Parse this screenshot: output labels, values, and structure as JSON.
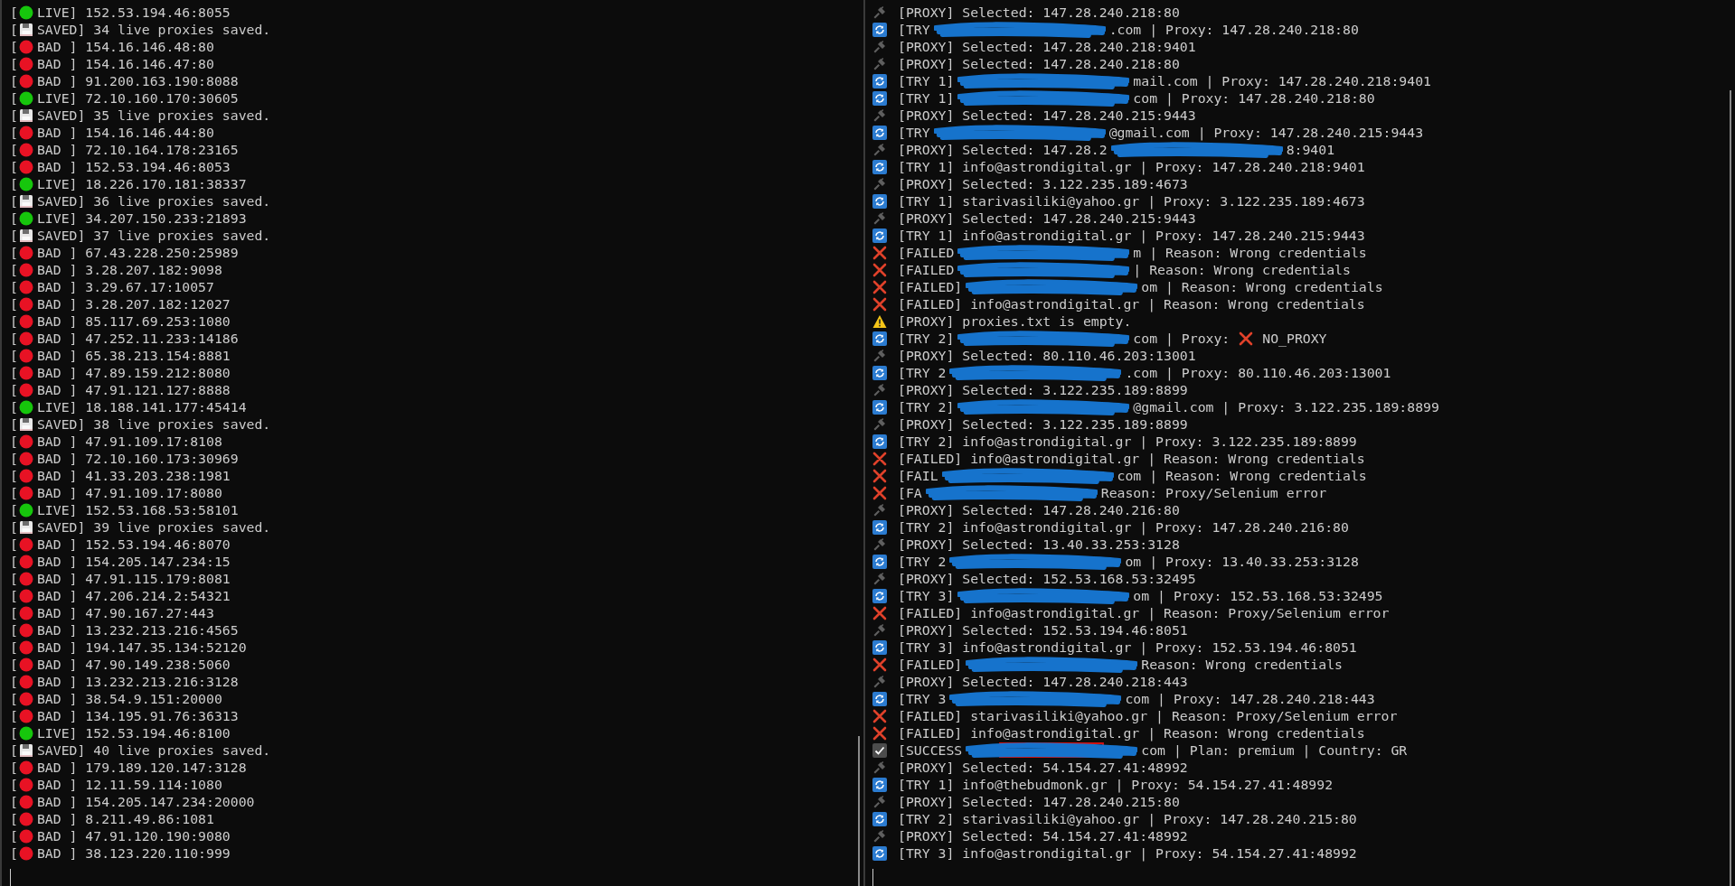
{
  "left_pane": {
    "lines": [
      {
        "kind": "live",
        "bracket": "[",
        "text": "LIVE] 152.53.194.46:8055"
      },
      {
        "kind": "saved",
        "bracket": "[",
        "text": "SAVED] 34 live proxies saved."
      },
      {
        "kind": "bad",
        "bracket": "[",
        "text": "BAD ] 154.16.146.48:80"
      },
      {
        "kind": "bad",
        "bracket": "[",
        "text": "BAD ] 154.16.146.47:80"
      },
      {
        "kind": "bad",
        "bracket": "[",
        "text": "BAD ] 91.200.163.190:8088"
      },
      {
        "kind": "live",
        "bracket": "[",
        "text": "LIVE] 72.10.160.170:30605"
      },
      {
        "kind": "saved",
        "bracket": "[",
        "text": "SAVED] 35 live proxies saved."
      },
      {
        "kind": "bad",
        "bracket": "[",
        "text": "BAD ] 154.16.146.44:80"
      },
      {
        "kind": "bad",
        "bracket": "[",
        "text": "BAD ] 72.10.164.178:23165"
      },
      {
        "kind": "bad",
        "bracket": "[",
        "text": "BAD ] 152.53.194.46:8053"
      },
      {
        "kind": "live",
        "bracket": "[",
        "text": "LIVE] 18.226.170.181:38337"
      },
      {
        "kind": "saved",
        "bracket": "[",
        "text": "SAVED] 36 live proxies saved."
      },
      {
        "kind": "live",
        "bracket": "[",
        "text": "LIVE] 34.207.150.233:21893"
      },
      {
        "kind": "saved",
        "bracket": "[",
        "text": "SAVED] 37 live proxies saved."
      },
      {
        "kind": "bad",
        "bracket": "[",
        "text": "BAD ] 67.43.228.250:25989"
      },
      {
        "kind": "bad",
        "bracket": "[",
        "text": "BAD ] 3.28.207.182:9098"
      },
      {
        "kind": "bad",
        "bracket": "[",
        "text": "BAD ] 3.29.67.17:10057"
      },
      {
        "kind": "bad",
        "bracket": "[",
        "text": "BAD ] 3.28.207.182:12027"
      },
      {
        "kind": "bad",
        "bracket": "[",
        "text": "BAD ] 85.117.69.253:1080"
      },
      {
        "kind": "bad",
        "bracket": "[",
        "text": "BAD ] 47.252.11.233:14186"
      },
      {
        "kind": "bad",
        "bracket": "[",
        "text": "BAD ] 65.38.213.154:8881"
      },
      {
        "kind": "bad",
        "bracket": "[",
        "text": "BAD ] 47.89.159.212:8080"
      },
      {
        "kind": "bad",
        "bracket": "[",
        "text": "BAD ] 47.91.121.127:8888"
      },
      {
        "kind": "live",
        "bracket": "[",
        "text": "LIVE] 18.188.141.177:45414"
      },
      {
        "kind": "saved",
        "bracket": "[",
        "text": "SAVED] 38 live proxies saved."
      },
      {
        "kind": "bad",
        "bracket": "[",
        "text": "BAD ] 47.91.109.17:8108"
      },
      {
        "kind": "bad",
        "bracket": "[",
        "text": "BAD ] 72.10.160.173:30969"
      },
      {
        "kind": "bad",
        "bracket": "[",
        "text": "BAD ] 41.33.203.238:1981"
      },
      {
        "kind": "bad",
        "bracket": "[",
        "text": "BAD ] 47.91.109.17:8080"
      },
      {
        "kind": "live",
        "bracket": "[",
        "text": "LIVE] 152.53.168.53:58101"
      },
      {
        "kind": "saved",
        "bracket": "[",
        "text": "SAVED] 39 live proxies saved."
      },
      {
        "kind": "bad",
        "bracket": "[",
        "text": "BAD ] 152.53.194.46:8070"
      },
      {
        "kind": "bad",
        "bracket": "[",
        "text": "BAD ] 154.205.147.234:15"
      },
      {
        "kind": "bad",
        "bracket": "[",
        "text": "BAD ] 47.91.115.179:8081"
      },
      {
        "kind": "bad",
        "bracket": "[",
        "text": "BAD ] 47.206.214.2:54321"
      },
      {
        "kind": "bad",
        "bracket": "[",
        "text": "BAD ] 47.90.167.27:443"
      },
      {
        "kind": "bad",
        "bracket": "[",
        "text": "BAD ] 13.232.213.216:4565"
      },
      {
        "kind": "bad",
        "bracket": "[",
        "text": "BAD ] 194.147.35.134:52120"
      },
      {
        "kind": "bad",
        "bracket": "[",
        "text": "BAD ] 47.90.149.238:5060"
      },
      {
        "kind": "bad",
        "bracket": "[",
        "text": "BAD ] 13.232.213.216:3128"
      },
      {
        "kind": "bad",
        "bracket": "[",
        "text": "BAD ] 38.54.9.151:20000"
      },
      {
        "kind": "bad",
        "bracket": "[",
        "text": "BAD ] 134.195.91.76:36313"
      },
      {
        "kind": "live",
        "bracket": "[",
        "text": "LIVE] 152.53.194.46:8100"
      },
      {
        "kind": "saved",
        "bracket": "[",
        "text": "SAVED] 40 live proxies saved."
      },
      {
        "kind": "bad",
        "bracket": "[",
        "text": "BAD ] 179.189.120.147:3128"
      },
      {
        "kind": "bad",
        "bracket": "[",
        "text": "BAD ] 12.11.59.114:1080"
      },
      {
        "kind": "bad",
        "bracket": "[",
        "text": "BAD ] 154.205.147.234:20000"
      },
      {
        "kind": "bad",
        "bracket": "[",
        "text": "BAD ] 8.211.49.86:1081"
      },
      {
        "kind": "bad",
        "bracket": "[",
        "text": "BAD ] 47.91.120.190:9080"
      },
      {
        "kind": "bad",
        "bracket": "[",
        "text": "BAD ] 38.123.220.110:999"
      }
    ]
  },
  "right_pane": {
    "lines": [
      {
        "kind": "proxy",
        "text": "[PROXY] Selected: 147.28.240.218:80"
      },
      {
        "kind": "try",
        "segments": [
          {
            "kind": "text",
            "text": "[TRY"
          },
          {
            "kind": "redaction"
          },
          {
            "kind": "text",
            "text": ".com | Proxy: 147.28.240.218:80"
          }
        ]
      },
      {
        "kind": "proxy",
        "text": "[PROXY] Selected: 147.28.240.218:9401"
      },
      {
        "kind": "proxy",
        "text": "[PROXY] Selected: 147.28.240.218:80"
      },
      {
        "kind": "try",
        "segments": [
          {
            "kind": "text",
            "text": "[TRY 1]"
          },
          {
            "kind": "redaction"
          },
          {
            "kind": "text",
            "text": "mail.com | Proxy: 147.28.240.218:9401"
          }
        ]
      },
      {
        "kind": "try",
        "segments": [
          {
            "kind": "text",
            "text": "[TRY 1]"
          },
          {
            "kind": "redaction"
          },
          {
            "kind": "text",
            "text": "com | Proxy: 147.28.240.218:80"
          }
        ]
      },
      {
        "kind": "proxy",
        "text": "[PROXY] Selected: 147.28.240.215:9443"
      },
      {
        "kind": "try",
        "segments": [
          {
            "kind": "text",
            "text": "[TRY"
          },
          {
            "kind": "redaction"
          },
          {
            "kind": "text",
            "text": "@gmail.com | Proxy: 147.28.240.215:9443"
          }
        ]
      },
      {
        "kind": "proxy",
        "segments": [
          {
            "kind": "text",
            "text": "[PROXY] Selected: 147.28.2"
          },
          {
            "kind": "redaction"
          },
          {
            "kind": "text",
            "text": "8:9401"
          }
        ]
      },
      {
        "kind": "try",
        "text": "[TRY 1] info@astrondigital.gr | Proxy: 147.28.240.218:9401"
      },
      {
        "kind": "proxy",
        "text": "[PROXY] Selected: 3.122.235.189:4673"
      },
      {
        "kind": "try",
        "text": "[TRY 1] starivasiliki@yahoo.gr | Proxy: 3.122.235.189:4673"
      },
      {
        "kind": "proxy",
        "text": "[PROXY] Selected: 147.28.240.215:9443"
      },
      {
        "kind": "try",
        "text": "[TRY 1] info@astrondigital.gr | Proxy: 147.28.240.215:9443"
      },
      {
        "kind": "failed",
        "segments": [
          {
            "kind": "text",
            "text": "[FAILED"
          },
          {
            "kind": "redaction"
          },
          {
            "kind": "text",
            "text": "m | Reason: Wrong credentials"
          }
        ]
      },
      {
        "kind": "failed",
        "segments": [
          {
            "kind": "text",
            "text": "[FAILED"
          },
          {
            "kind": "redaction"
          },
          {
            "kind": "text",
            "text": "| Reason: Wrong credentials"
          }
        ]
      },
      {
        "kind": "failed",
        "segments": [
          {
            "kind": "text",
            "text": "[FAILED]"
          },
          {
            "kind": "redaction"
          },
          {
            "kind": "text",
            "text": "om | Reason: Wrong credentials"
          }
        ]
      },
      {
        "kind": "failed",
        "text": "[FAILED] info@astrondigital.gr | Reason: Wrong credentials"
      },
      {
        "kind": "warning",
        "text": "[PROXY] proxies.txt is empty."
      },
      {
        "kind": "try",
        "segments": [
          {
            "kind": "text",
            "text": "[TRY 2]"
          },
          {
            "kind": "redaction"
          },
          {
            "kind": "text",
            "text": "com | Proxy:"
          },
          {
            "kind": "cross"
          },
          {
            "kind": "text",
            "text": "NO_PROXY"
          }
        ]
      },
      {
        "kind": "proxy",
        "text": "[PROXY] Selected: 80.110.46.203:13001"
      },
      {
        "kind": "try",
        "segments": [
          {
            "kind": "text",
            "text": "[TRY 2"
          },
          {
            "kind": "redaction"
          },
          {
            "kind": "text",
            "text": ".com | Proxy: 80.110.46.203:13001"
          }
        ]
      },
      {
        "kind": "proxy",
        "text": "[PROXY] Selected: 3.122.235.189:8899"
      },
      {
        "kind": "try",
        "segments": [
          {
            "kind": "text",
            "text": "[TRY 2]"
          },
          {
            "kind": "redaction"
          },
          {
            "kind": "text",
            "text": "@gmail.com | Proxy: 3.122.235.189:8899"
          }
        ]
      },
      {
        "kind": "proxy",
        "text": "[PROXY] Selected: 3.122.235.189:8899"
      },
      {
        "kind": "try",
        "text": "[TRY 2] info@astrondigital.gr | Proxy: 3.122.235.189:8899"
      },
      {
        "kind": "failed",
        "text": "[FAILED] info@astrondigital.gr | Reason: Wrong credentials"
      },
      {
        "kind": "failed",
        "segments": [
          {
            "kind": "text",
            "text": "[FAIL"
          },
          {
            "kind": "redaction"
          },
          {
            "kind": "text",
            "text": "com | Reason: Wrong credentials"
          }
        ]
      },
      {
        "kind": "failed",
        "segments": [
          {
            "kind": "text",
            "text": "[FA"
          },
          {
            "kind": "redaction"
          },
          {
            "kind": "text",
            "text": "Reason: Proxy/Selenium error"
          }
        ]
      },
      {
        "kind": "proxy",
        "text": "[PROXY] Selected: 147.28.240.216:80"
      },
      {
        "kind": "try",
        "text": "[TRY 2] info@astrondigital.gr | Proxy: 147.28.240.216:80"
      },
      {
        "kind": "proxy",
        "text": "[PROXY] Selected: 13.40.33.253:3128"
      },
      {
        "kind": "try",
        "segments": [
          {
            "kind": "text",
            "text": "[TRY 2"
          },
          {
            "kind": "redaction"
          },
          {
            "kind": "text",
            "text": "om | Proxy: 13.40.33.253:3128"
          }
        ]
      },
      {
        "kind": "proxy",
        "text": "[PROXY] Selected: 152.53.168.53:32495"
      },
      {
        "kind": "try",
        "segments": [
          {
            "kind": "text",
            "text": "[TRY 3]"
          },
          {
            "kind": "redaction"
          },
          {
            "kind": "text",
            "text": "om | Proxy: 152.53.168.53:32495"
          }
        ]
      },
      {
        "kind": "failed",
        "text": "[FAILED] info@astrondigital.gr | Reason: Proxy/Selenium error"
      },
      {
        "kind": "proxy",
        "text": "[PROXY] Selected: 152.53.194.46:8051"
      },
      {
        "kind": "try",
        "text": "[TRY 3] info@astrondigital.gr | Proxy: 152.53.194.46:8051"
      },
      {
        "kind": "failed",
        "segments": [
          {
            "kind": "text",
            "text": "[FAILED]"
          },
          {
            "kind": "redaction"
          },
          {
            "kind": "text",
            "text": "Reason: Wrong credentials"
          }
        ]
      },
      {
        "kind": "proxy",
        "text": "[PROXY] Selected: 147.28.240.218:443"
      },
      {
        "kind": "try",
        "segments": [
          {
            "kind": "text",
            "text": "[TRY 3"
          },
          {
            "kind": "redaction"
          },
          {
            "kind": "text",
            "text": "com | Proxy: 147.28.240.218:443"
          }
        ]
      },
      {
        "kind": "failed",
        "text": "[FAILED] starivasiliki@yahoo.gr | Reason: Proxy/Selenium error"
      },
      {
        "kind": "failed",
        "text": "[FAILED] info@astrondigital.gr | Reason: Wrong credentials"
      },
      {
        "kind": "success",
        "segments": [
          {
            "kind": "text",
            "text": "[SUCCESS"
          },
          {
            "kind": "boxed-redaction"
          },
          {
            "kind": "text",
            "text": "com | Plan: premium | Country: GR"
          }
        ]
      },
      {
        "kind": "proxy",
        "text": "[PROXY] Selected: 54.154.27.41:48992"
      },
      {
        "kind": "try",
        "text": "[TRY 1] info@thebudmonk.gr | Proxy: 54.154.27.41:48992"
      },
      {
        "kind": "proxy",
        "text": "[PROXY] Selected: 147.28.240.215:80"
      },
      {
        "kind": "try",
        "text": "[TRY 2] starivasiliki@yahoo.gr | Proxy: 147.28.240.215:80"
      },
      {
        "kind": "proxy",
        "text": "[PROXY] Selected: 54.154.27.41:48992"
      },
      {
        "kind": "try",
        "text": "[TRY 3] info@astrondigital.gr | Proxy: 54.154.27.41:48992"
      }
    ]
  }
}
